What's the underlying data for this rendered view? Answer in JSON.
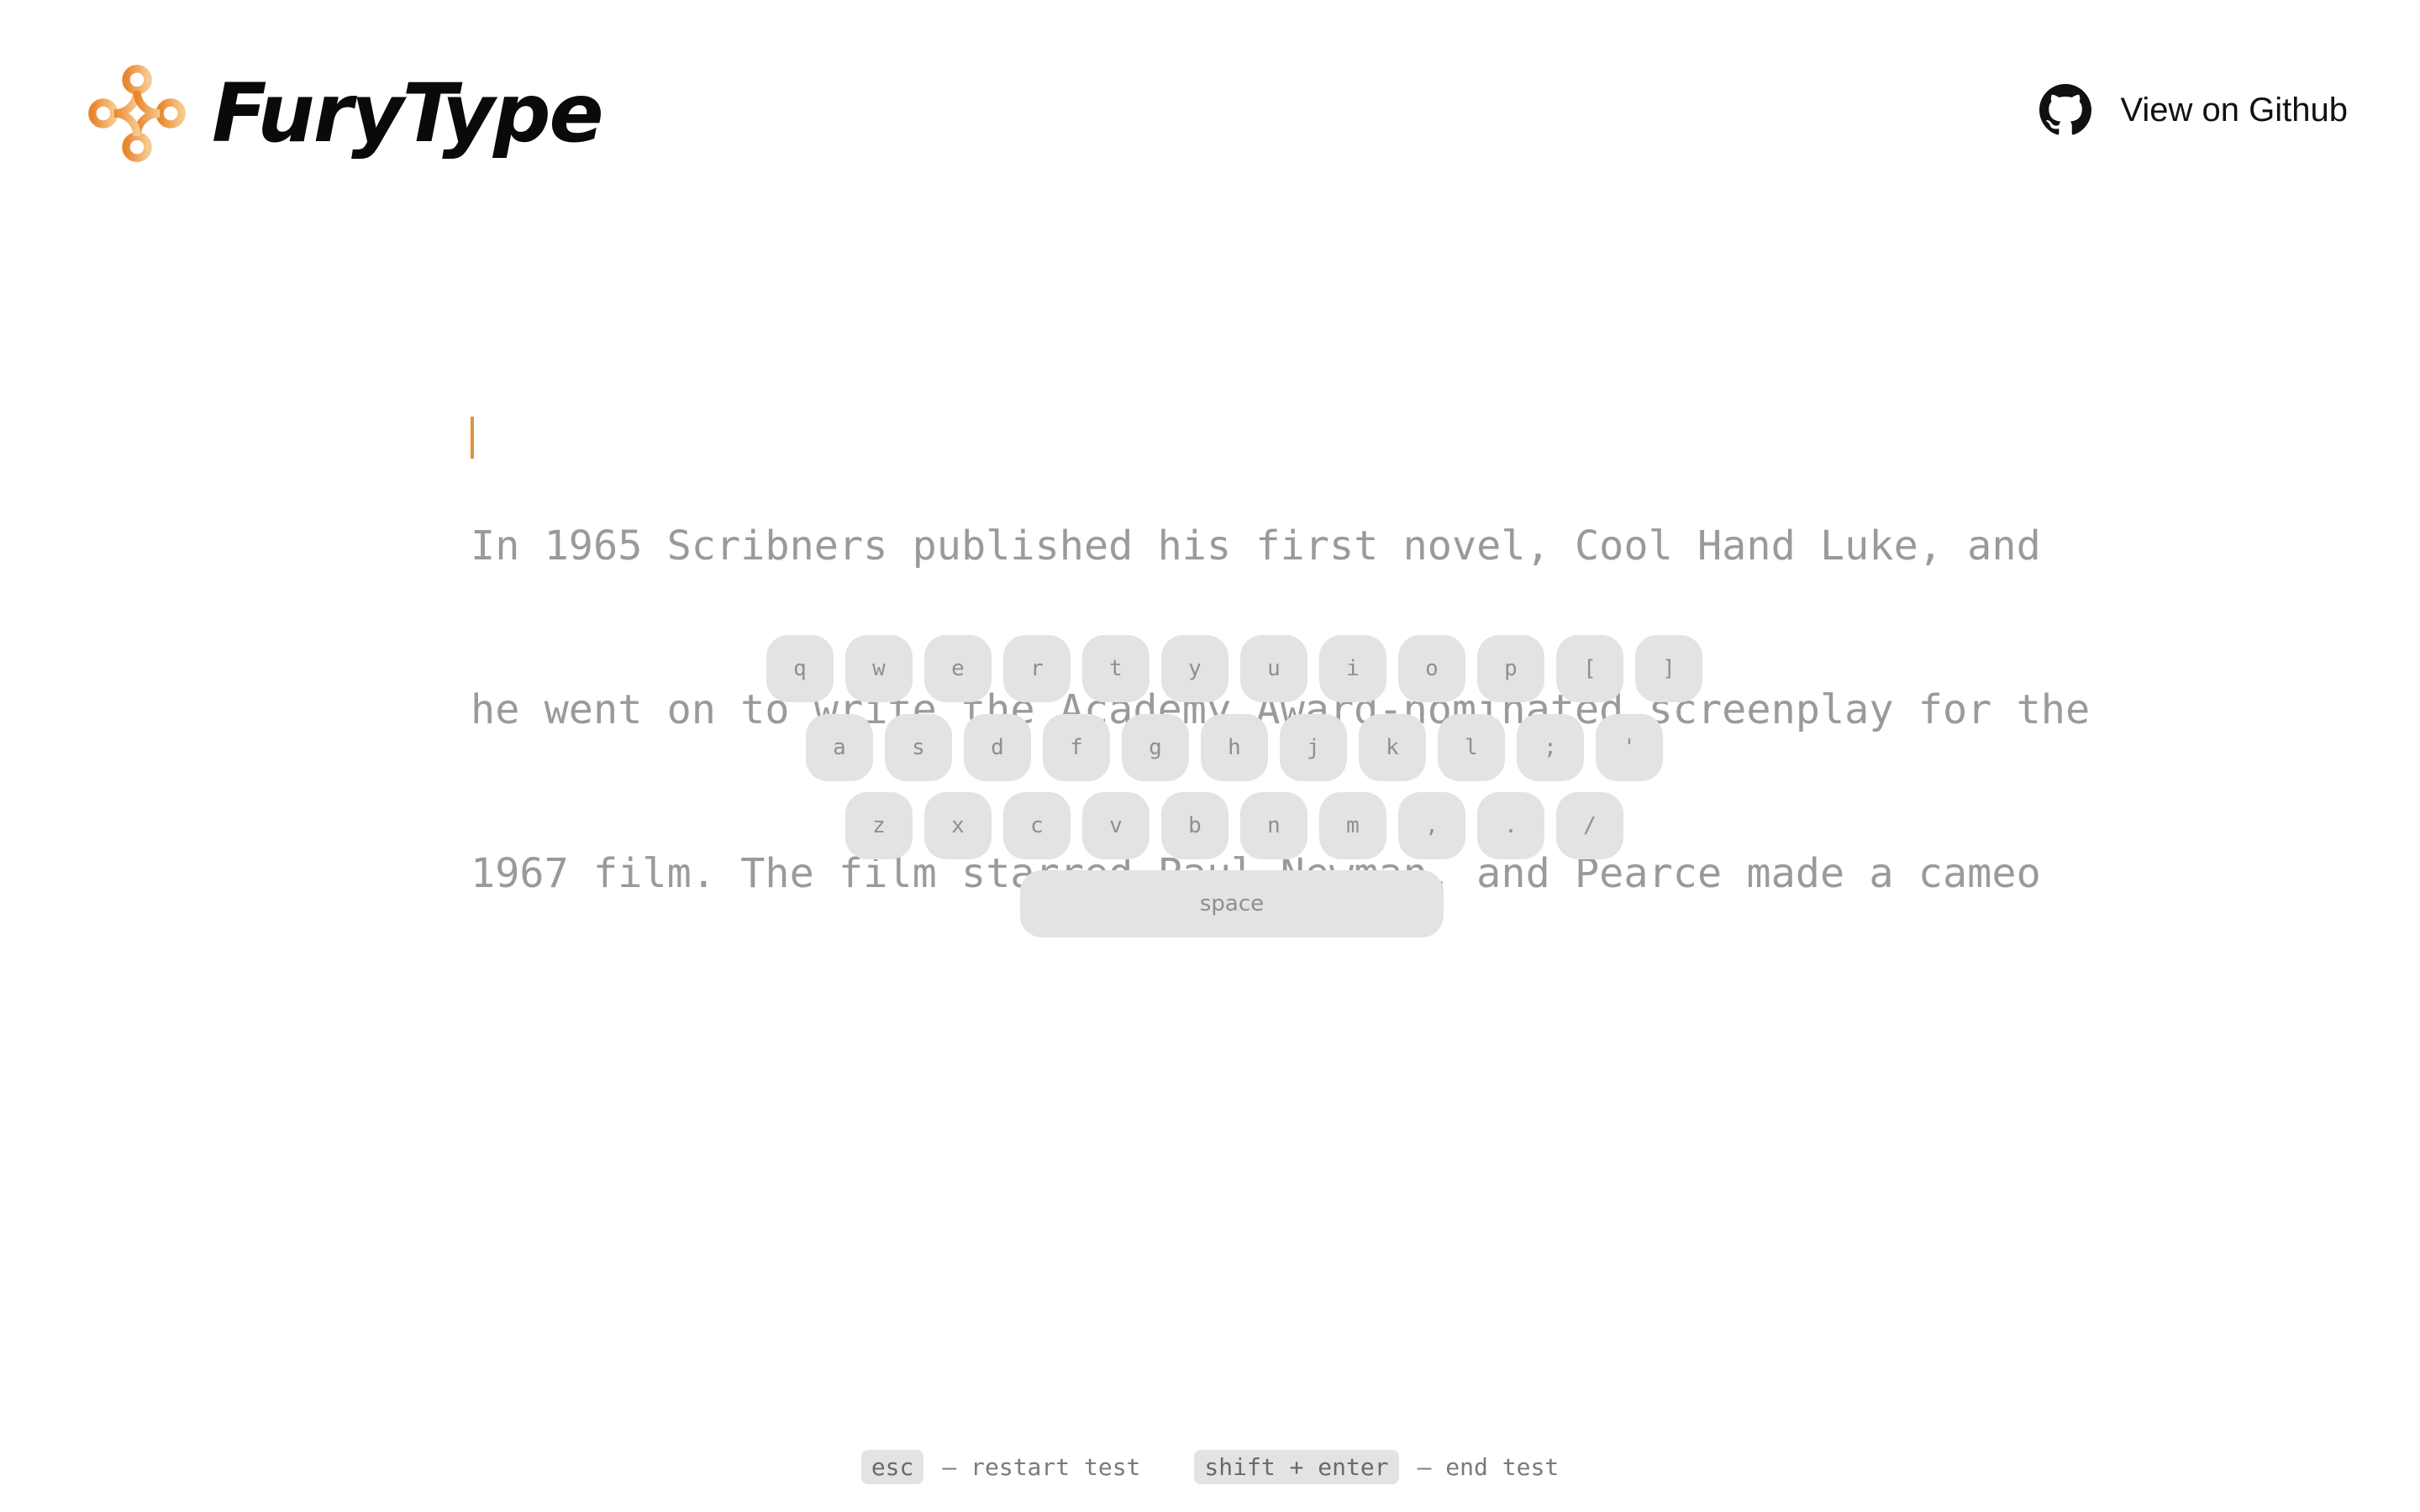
{
  "header": {
    "app_name": "FuryType",
    "github_label": "View on Github",
    "brand_color": "#e0923a"
  },
  "passage": {
    "lines": [
      "In 1965 Scribners published his first novel, Cool Hand Luke, and",
      "he went on to write the Academy Award-nominated screenplay for the",
      "1967 film. The film starred Paul Newman, and Pearce made a cameo"
    ]
  },
  "keyboard": {
    "row1": [
      "q",
      "w",
      "e",
      "r",
      "t",
      "y",
      "u",
      "i",
      "o",
      "p",
      "[",
      "]"
    ],
    "row2": [
      "a",
      "s",
      "d",
      "f",
      "g",
      "h",
      "j",
      "k",
      "l",
      ";",
      "'"
    ],
    "row3": [
      "z",
      "x",
      "c",
      "v",
      "b",
      "n",
      "m",
      ",",
      ".",
      "/"
    ],
    "space": "space"
  },
  "footer": {
    "hint1_key": "esc",
    "hint1_text": "— restart test",
    "hint2_key": "shift + enter",
    "hint2_text": "— end test"
  }
}
